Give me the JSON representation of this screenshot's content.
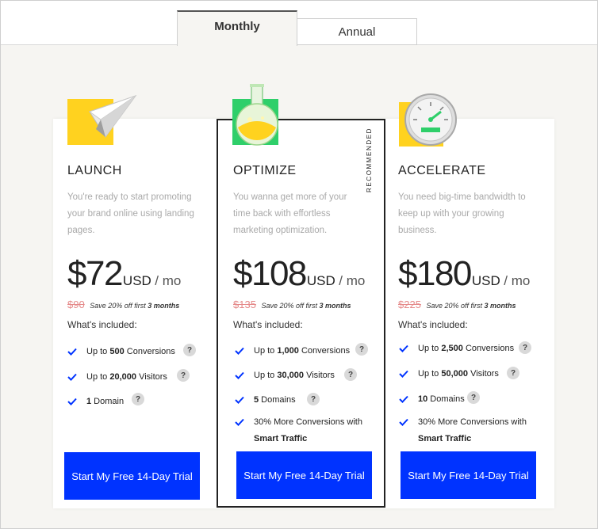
{
  "tabs": [
    {
      "label": "Monthly",
      "active": true
    },
    {
      "label": "Annual",
      "active": false
    }
  ],
  "recommended_label": "RECOMMENDED",
  "plans": [
    {
      "name": "LAUNCH",
      "description": "You're ready to start promoting your brand online using landing pages.",
      "price": "$72",
      "currency": "USD",
      "period": "/ mo",
      "old_price": "$90",
      "save_prefix": "Save 20% off first",
      "save_months": "3 months",
      "included_label": "What's included:",
      "features": [
        {
          "pre": "Up to ",
          "bold": "500",
          "post": " Conversions",
          "tooltip": "?"
        },
        {
          "pre": "Up to ",
          "bold": "20,000",
          "post": " Visitors",
          "tooltip": "?"
        },
        {
          "pre": "",
          "bold": "1",
          "post": " Domain",
          "tooltip": "?"
        }
      ],
      "cta": "Start My Free 14-Day Trial",
      "icon": "paper-plane-icon"
    },
    {
      "name": "OPTIMIZE",
      "description": "You wanna get more of your time back with effortless marketing optimization.",
      "price": "$108",
      "currency": "USD",
      "period": "/ mo",
      "old_price": "$135",
      "save_prefix": "Save 20% off first",
      "save_months": "3 months",
      "included_label": "What's included:",
      "features": [
        {
          "pre": "Up to ",
          "bold": "1,000",
          "post": " Conversions",
          "tooltip": "?"
        },
        {
          "pre": "Up to ",
          "bold": "30,000",
          "post": " Visitors",
          "tooltip": "?"
        },
        {
          "pre": "",
          "bold": "5",
          "post": " Domains",
          "tooltip": "?"
        },
        {
          "pre": "30% More Conversions with",
          "bold": "Smart Traffic",
          "post": "",
          "tooltip": ""
        }
      ],
      "cta": "Start My Free 14-Day Trial",
      "icon": "flask-icon"
    },
    {
      "name": "ACCELERATE",
      "description": "You need big-time bandwidth to keep up with your growing business.",
      "price": "$180",
      "currency": "USD",
      "period": "/ mo",
      "old_price": "$225",
      "save_prefix": "Save 20% off first",
      "save_months": "3 months",
      "included_label": "What's included:",
      "features": [
        {
          "pre": "Up to ",
          "bold": "2,500",
          "post": " Conversions",
          "tooltip": "?"
        },
        {
          "pre": "Up to ",
          "bold": "50,000",
          "post": " Visitors",
          "tooltip": "?"
        },
        {
          "pre": "",
          "bold": "10",
          "post": " Domains",
          "tooltip": "?"
        },
        {
          "pre": "30% More Conversions with",
          "bold": "Smart Traffic",
          "post": "",
          "tooltip": ""
        }
      ],
      "cta": "Start My Free 14-Day Trial",
      "icon": "speedometer-icon"
    }
  ],
  "colors": {
    "accent": "#0033ff",
    "old_price": "#e58a8a",
    "icon_yellow": "#ffd21f",
    "icon_green": "#2fcf6a"
  }
}
